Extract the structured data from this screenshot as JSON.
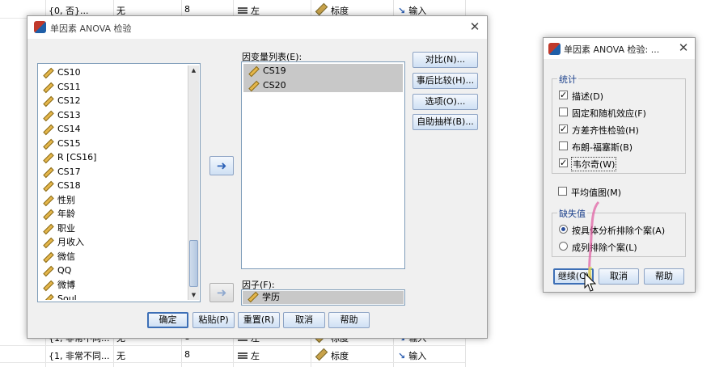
{
  "sheet": {
    "top_row": {
      "values": "{0, 否}...",
      "missing": "无",
      "columns": "8",
      "align": "左",
      "measure": "标度",
      "role": "输入"
    },
    "bottom_rows": [
      {
        "values": "{1, 非常不同...",
        "missing": "无",
        "columns": "8",
        "align": "左",
        "measure": "标度",
        "role": "输入"
      },
      {
        "values": "{1, 非常不同...",
        "missing": "无",
        "columns": "8",
        "align": "左",
        "measure": "标度",
        "role": "输入"
      }
    ]
  },
  "main_dialog": {
    "title": "单因素 ANOVA 检验",
    "close": "✕",
    "source_vars": [
      {
        "label": "CS10",
        "icon": "ruler-icon"
      },
      {
        "label": "CS11",
        "icon": "ruler-icon"
      },
      {
        "label": "CS12",
        "icon": "ruler-icon"
      },
      {
        "label": "CS13",
        "icon": "ruler-icon"
      },
      {
        "label": "CS14",
        "icon": "ruler-icon"
      },
      {
        "label": "CS15",
        "icon": "ruler-icon"
      },
      {
        "label": "R [CS16]",
        "icon": "ruler-icon"
      },
      {
        "label": "CS17",
        "icon": "ruler-icon"
      },
      {
        "label": "CS18",
        "icon": "ruler-icon"
      },
      {
        "label": "性别",
        "icon": "ruler-icon"
      },
      {
        "label": "年龄",
        "icon": "ruler-icon"
      },
      {
        "label": "职业",
        "icon": "ruler-icon"
      },
      {
        "label": "月收入",
        "icon": "ruler-icon"
      },
      {
        "label": "微信",
        "icon": "ruler-icon"
      },
      {
        "label": "QQ",
        "icon": "ruler-icon"
      },
      {
        "label": "微博",
        "icon": "ruler-icon"
      },
      {
        "label": "Soul",
        "icon": "ruler-icon"
      }
    ],
    "dependent_label": "因变量列表(E):",
    "dependent_vars": [
      "CS19",
      "CS20"
    ],
    "factor_label": "因子(F):",
    "factor_var": "学历",
    "side_buttons": {
      "contrasts": "对比(N)...",
      "post_hoc": "事后比较(H)...",
      "options": "选项(O)...",
      "bootstrap": "自助抽样(B)..."
    },
    "bottom_buttons": {
      "ok": "确定",
      "paste": "粘贴(P)",
      "reset": "重置(R)",
      "cancel": "取消",
      "help": "帮助"
    }
  },
  "options_dialog": {
    "title": "单因素 ANOVA 检验: ...",
    "close": "✕",
    "stats_group": "统计",
    "stats": [
      {
        "label": "描述(D)",
        "checked": true
      },
      {
        "label": "固定和随机效应(F)",
        "checked": false
      },
      {
        "label": "方差齐性检验(H)",
        "checked": true
      },
      {
        "label": "布朗-福塞斯(B)",
        "checked": false
      },
      {
        "label": "韦尔奇(W)",
        "checked": true
      }
    ],
    "means_plot": {
      "label": "平均值图(M)",
      "checked": false
    },
    "missing_group": "缺失值",
    "missing_options": [
      {
        "label": "按具体分析排除个案(A)",
        "selected": true
      },
      {
        "label": "成列排除个案(L)",
        "selected": false
      }
    ],
    "buttons": {
      "continue": "继续(C)",
      "cancel": "取消",
      "help": "帮助"
    },
    "check_mark": "✓"
  }
}
